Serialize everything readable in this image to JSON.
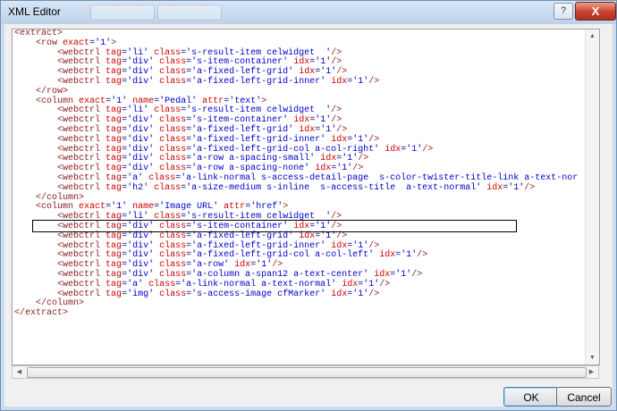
{
  "window": {
    "title": "XML Editor",
    "help_glyph": "?",
    "close_glyph": "X"
  },
  "editor": {
    "lines": [
      "<extract>",
      "    <row exact='1'>",
      "        <webctrl tag='li' class='s-result-item celwidget  '/>",
      "        <webctrl tag='div' class='s-item-container' idx='1'/>",
      "        <webctrl tag='div' class='a-fixed-left-grid' idx='1'/>",
      "        <webctrl tag='div' class='a-fixed-left-grid-inner' idx='1'/>",
      "    </row>",
      "    <column exact='1' name='Pedal' attr='text'>",
      "        <webctrl tag='li' class='s-result-item celwidget  '/>",
      "        <webctrl tag='div' class='s-item-container' idx='1'/>",
      "        <webctrl tag='div' class='a-fixed-left-grid' idx='1'/>",
      "        <webctrl tag='div' class='a-fixed-left-grid-inner' idx='1'/>",
      "        <webctrl tag='div' class='a-fixed-left-grid-col a-col-right' idx='1'/>",
      "        <webctrl tag='div' class='a-row a-spacing-small' idx='1'/>",
      "        <webctrl tag='div' class='a-row a-spacing-none' idx='1'/>",
      "        <webctrl tag='a' class='a-link-normal s-access-detail-page  s-color-twister-title-link a-text-nor",
      "        <webctrl tag='h2' class='a-size-medium s-inline  s-access-title  a-text-normal' idx='1'/>",
      "    </column>",
      "    <column exact='1' name='Image URL' attr='href'>",
      "        <webctrl tag='li' class='s-result-item celwidget  '/>",
      "        <webctrl tag='div' class='s-item-container' idx='1'/>",
      "        <webctrl tag='div' class='a-fixed-left-grid' idx='1'/>",
      "        <webctrl tag='div' class='a-fixed-left-grid-inner' idx='1'/>",
      "        <webctrl tag='div' class='a-fixed-left-grid-col a-col-left' idx='1'/>",
      "        <webctrl tag='div' class='a-row' idx='1'/>",
      "        <webctrl tag='div' class='a-column a-span12 a-text-center' idx='1'/>",
      "        <webctrl tag='a' class='a-link-normal a-text-normal' idx='1'/>",
      "        <webctrl tag='img' class='s-access-image cfMarker' idx='1'/>",
      "    </column>",
      "</extract>"
    ]
  },
  "buttons": {
    "ok": "OK",
    "cancel": "Cancel"
  },
  "colors": {
    "tag": "#8b1a1a",
    "attr_name": "#cc0000",
    "attr_value": "#0000cc",
    "text": "#00008b"
  }
}
